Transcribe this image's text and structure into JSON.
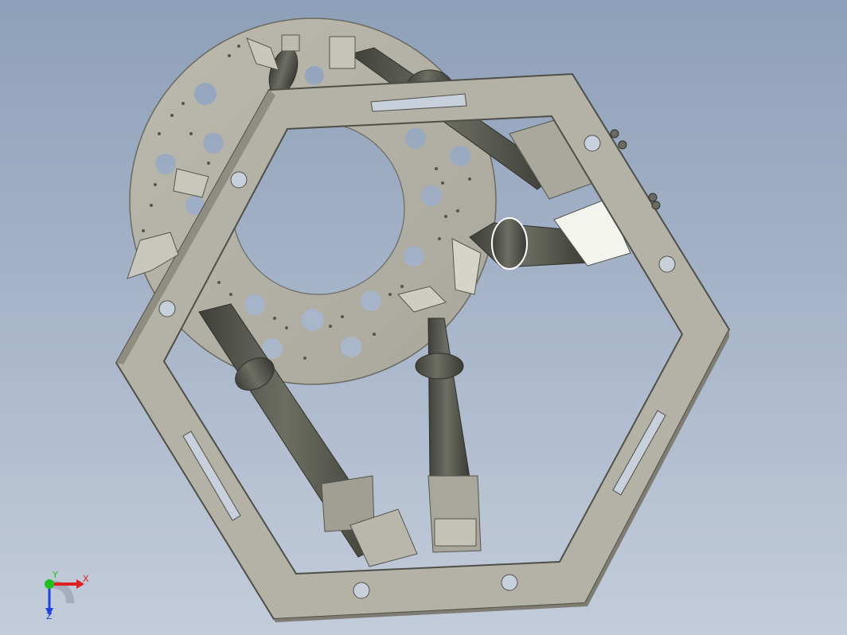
{
  "viewport": {
    "background_top": "#8ea0b9",
    "background_bottom": "#c3ccda",
    "part_color": "#b3b1a4",
    "part_edge_color": "#55554f",
    "cylinder_color": "#5b5c52"
  },
  "triad": {
    "x_label": "X",
    "y_label": "Y",
    "z_label": "Z",
    "x_color": "#e02020",
    "y_color": "#20c020",
    "z_color": "#2040e0"
  }
}
